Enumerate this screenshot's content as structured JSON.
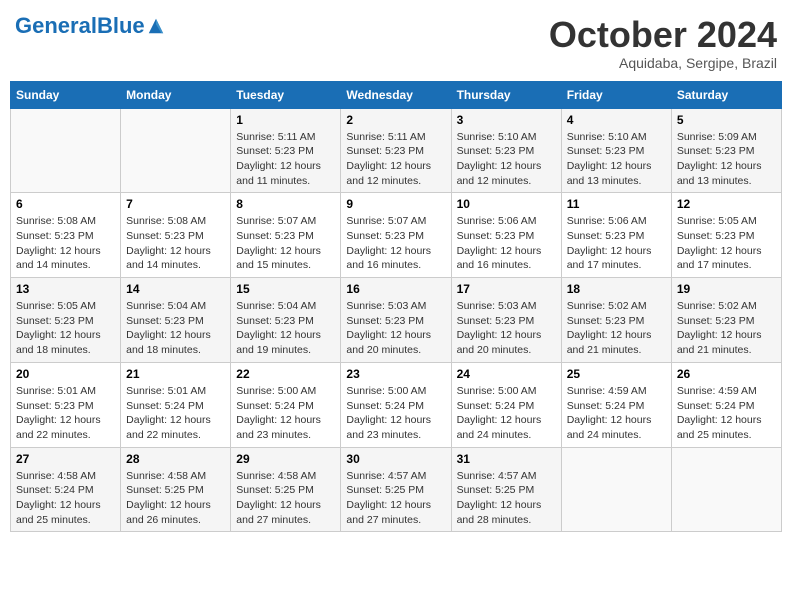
{
  "header": {
    "logo_general": "General",
    "logo_blue": "Blue",
    "month_title": "October 2024",
    "location": "Aquidaba, Sergipe, Brazil"
  },
  "calendar": {
    "days_of_week": [
      "Sunday",
      "Monday",
      "Tuesday",
      "Wednesday",
      "Thursday",
      "Friday",
      "Saturday"
    ],
    "weeks": [
      [
        {
          "day": "",
          "info": ""
        },
        {
          "day": "",
          "info": ""
        },
        {
          "day": "1",
          "info": "Sunrise: 5:11 AM\nSunset: 5:23 PM\nDaylight: 12 hours\nand 11 minutes."
        },
        {
          "day": "2",
          "info": "Sunrise: 5:11 AM\nSunset: 5:23 PM\nDaylight: 12 hours\nand 12 minutes."
        },
        {
          "day": "3",
          "info": "Sunrise: 5:10 AM\nSunset: 5:23 PM\nDaylight: 12 hours\nand 12 minutes."
        },
        {
          "day": "4",
          "info": "Sunrise: 5:10 AM\nSunset: 5:23 PM\nDaylight: 12 hours\nand 13 minutes."
        },
        {
          "day": "5",
          "info": "Sunrise: 5:09 AM\nSunset: 5:23 PM\nDaylight: 12 hours\nand 13 minutes."
        }
      ],
      [
        {
          "day": "6",
          "info": "Sunrise: 5:08 AM\nSunset: 5:23 PM\nDaylight: 12 hours\nand 14 minutes."
        },
        {
          "day": "7",
          "info": "Sunrise: 5:08 AM\nSunset: 5:23 PM\nDaylight: 12 hours\nand 14 minutes."
        },
        {
          "day": "8",
          "info": "Sunrise: 5:07 AM\nSunset: 5:23 PM\nDaylight: 12 hours\nand 15 minutes."
        },
        {
          "day": "9",
          "info": "Sunrise: 5:07 AM\nSunset: 5:23 PM\nDaylight: 12 hours\nand 16 minutes."
        },
        {
          "day": "10",
          "info": "Sunrise: 5:06 AM\nSunset: 5:23 PM\nDaylight: 12 hours\nand 16 minutes."
        },
        {
          "day": "11",
          "info": "Sunrise: 5:06 AM\nSunset: 5:23 PM\nDaylight: 12 hours\nand 17 minutes."
        },
        {
          "day": "12",
          "info": "Sunrise: 5:05 AM\nSunset: 5:23 PM\nDaylight: 12 hours\nand 17 minutes."
        }
      ],
      [
        {
          "day": "13",
          "info": "Sunrise: 5:05 AM\nSunset: 5:23 PM\nDaylight: 12 hours\nand 18 minutes."
        },
        {
          "day": "14",
          "info": "Sunrise: 5:04 AM\nSunset: 5:23 PM\nDaylight: 12 hours\nand 18 minutes."
        },
        {
          "day": "15",
          "info": "Sunrise: 5:04 AM\nSunset: 5:23 PM\nDaylight: 12 hours\nand 19 minutes."
        },
        {
          "day": "16",
          "info": "Sunrise: 5:03 AM\nSunset: 5:23 PM\nDaylight: 12 hours\nand 20 minutes."
        },
        {
          "day": "17",
          "info": "Sunrise: 5:03 AM\nSunset: 5:23 PM\nDaylight: 12 hours\nand 20 minutes."
        },
        {
          "day": "18",
          "info": "Sunrise: 5:02 AM\nSunset: 5:23 PM\nDaylight: 12 hours\nand 21 minutes."
        },
        {
          "day": "19",
          "info": "Sunrise: 5:02 AM\nSunset: 5:23 PM\nDaylight: 12 hours\nand 21 minutes."
        }
      ],
      [
        {
          "day": "20",
          "info": "Sunrise: 5:01 AM\nSunset: 5:23 PM\nDaylight: 12 hours\nand 22 minutes."
        },
        {
          "day": "21",
          "info": "Sunrise: 5:01 AM\nSunset: 5:24 PM\nDaylight: 12 hours\nand 22 minutes."
        },
        {
          "day": "22",
          "info": "Sunrise: 5:00 AM\nSunset: 5:24 PM\nDaylight: 12 hours\nand 23 minutes."
        },
        {
          "day": "23",
          "info": "Sunrise: 5:00 AM\nSunset: 5:24 PM\nDaylight: 12 hours\nand 23 minutes."
        },
        {
          "day": "24",
          "info": "Sunrise: 5:00 AM\nSunset: 5:24 PM\nDaylight: 12 hours\nand 24 minutes."
        },
        {
          "day": "25",
          "info": "Sunrise: 4:59 AM\nSunset: 5:24 PM\nDaylight: 12 hours\nand 24 minutes."
        },
        {
          "day": "26",
          "info": "Sunrise: 4:59 AM\nSunset: 5:24 PM\nDaylight: 12 hours\nand 25 minutes."
        }
      ],
      [
        {
          "day": "27",
          "info": "Sunrise: 4:58 AM\nSunset: 5:24 PM\nDaylight: 12 hours\nand 25 minutes."
        },
        {
          "day": "28",
          "info": "Sunrise: 4:58 AM\nSunset: 5:25 PM\nDaylight: 12 hours\nand 26 minutes."
        },
        {
          "day": "29",
          "info": "Sunrise: 4:58 AM\nSunset: 5:25 PM\nDaylight: 12 hours\nand 27 minutes."
        },
        {
          "day": "30",
          "info": "Sunrise: 4:57 AM\nSunset: 5:25 PM\nDaylight: 12 hours\nand 27 minutes."
        },
        {
          "day": "31",
          "info": "Sunrise: 4:57 AM\nSunset: 5:25 PM\nDaylight: 12 hours\nand 28 minutes."
        },
        {
          "day": "",
          "info": ""
        },
        {
          "day": "",
          "info": ""
        }
      ]
    ]
  }
}
